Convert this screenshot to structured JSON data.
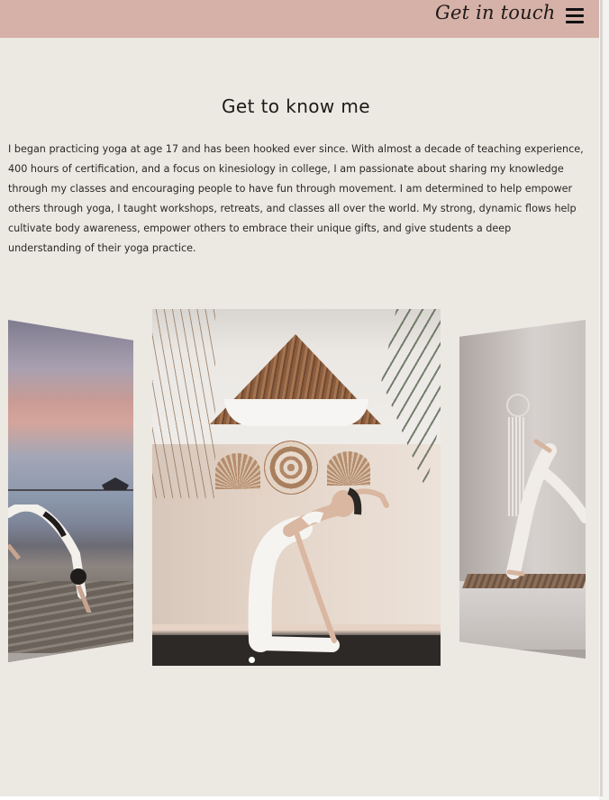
{
  "header": {
    "cta_label": "Get in touch",
    "menu_icon": "hamburger-menu-icon",
    "background_color": "#d6b1a7"
  },
  "about": {
    "title": "Get to know me",
    "paragraph": "I began practicing yoga at age 17 and has been hooked ever since. With almost a decade of teaching experience, 400 hours of certification, and a focus on kinesiology in college, I am passionate about sharing my knowledge through my classes and encouraging people to have fun through movement. I am determined to help empower others through yoga, I taught workshops, retreats, and classes all over the world. My strong, dynamic flows help cultivate body awareness, empower others to embrace their unique gifts, and give students a deep understanding of their yoga practice."
  },
  "gallery": {
    "slide_count": 3,
    "active_index": 1,
    "slides": [
      {
        "position": "previous",
        "image": "photo-wheel-pose-beach-deck"
      },
      {
        "position": "current",
        "image": "photo-camel-pose-studio"
      },
      {
        "position": "next",
        "image": "photo-split-pose-white-room"
      }
    ],
    "indicator_dots": 1
  },
  "colors": {
    "page_background": "#ece8e2",
    "text": "#2b2725",
    "accent": "#d6b1a7"
  }
}
